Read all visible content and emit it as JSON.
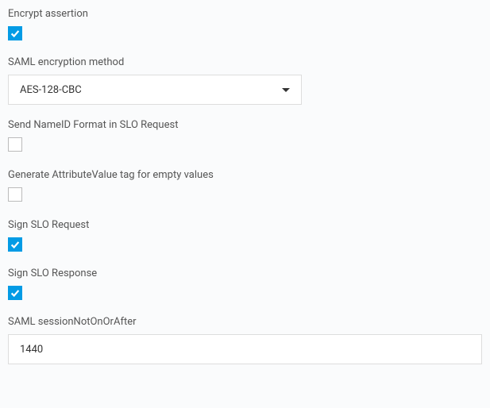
{
  "fields": {
    "encryptAssertion": {
      "label": "Encrypt assertion",
      "checked": true
    },
    "encryptionMethod": {
      "label": "SAML encryption method",
      "value": "AES-128-CBC"
    },
    "sendNameId": {
      "label": "Send NameID Format in SLO Request",
      "checked": false
    },
    "generateEmpty": {
      "label": "Generate AttributeValue tag for empty values",
      "checked": false
    },
    "signSloRequest": {
      "label": "Sign SLO Request",
      "checked": true
    },
    "signSloResponse": {
      "label": "Sign SLO Response",
      "checked": true
    },
    "sessionNotOnOrAfter": {
      "label": "SAML sessionNotOnOrAfter",
      "value": "1440"
    }
  }
}
